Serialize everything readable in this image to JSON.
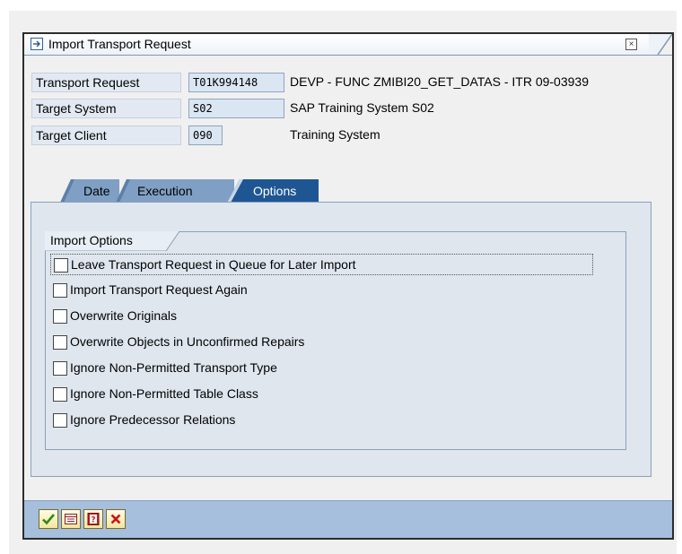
{
  "dialog": {
    "title": "Import Transport Request",
    "close_glyph": "×"
  },
  "fields": {
    "transport_request": {
      "label": "Transport Request",
      "value": "T01K994148",
      "description": "DEVP - FUNC ZMIBI20_GET_DATAS - ITR 09-03939"
    },
    "target_system": {
      "label": "Target System",
      "value": "S02",
      "description": "SAP Training System S02"
    },
    "target_client": {
      "label": "Target Client",
      "value": "090",
      "description": "Training System"
    }
  },
  "tabs": [
    {
      "label": "Date",
      "active": false
    },
    {
      "label": "Execution",
      "active": false
    },
    {
      "label": "Options",
      "active": true
    }
  ],
  "import_options": {
    "title": "Import Options",
    "items": [
      {
        "label": "Leave Transport Request in Queue for Later Import",
        "checked": false
      },
      {
        "label": "Import Transport Request Again",
        "checked": false
      },
      {
        "label": "Overwrite Originals",
        "checked": false
      },
      {
        "label": "Overwrite Objects in Unconfirmed Repairs",
        "checked": false
      },
      {
        "label": "Ignore Non-Permitted Transport Type",
        "checked": false
      },
      {
        "label": "Ignore Non-Permitted Table Class",
        "checked": false
      },
      {
        "label": "Ignore Predecessor Relations",
        "checked": false
      }
    ]
  },
  "toolbar": {
    "icons": [
      "checkmark-icon",
      "details-icon",
      "help-icon",
      "cancel-icon"
    ]
  },
  "colors": {
    "tab_active": "#1e5694",
    "tab_inactive": "#7f9fc4",
    "toolbar": "#a5bfdc",
    "panel": "#dfe6ee"
  }
}
